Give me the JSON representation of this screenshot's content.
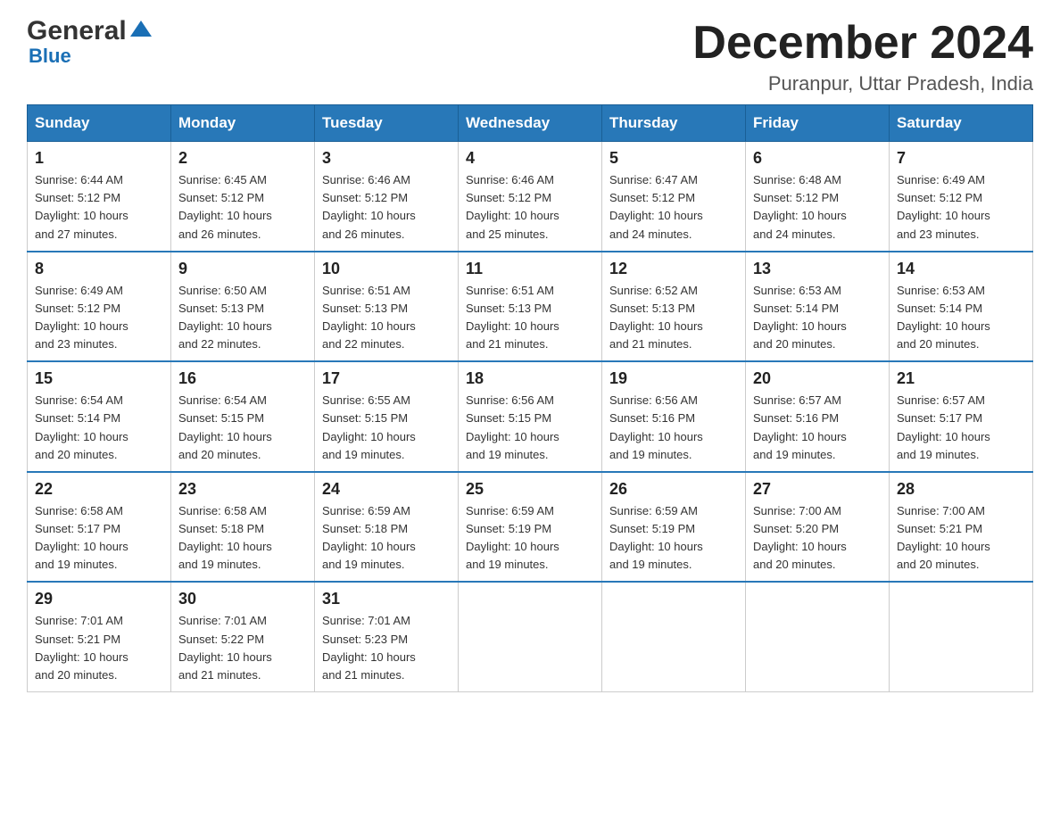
{
  "logo": {
    "general": "General",
    "blue": "Blue",
    "arrow": "▶"
  },
  "header": {
    "month_title": "December 2024",
    "location": "Puranpur, Uttar Pradesh, India"
  },
  "weekdays": [
    "Sunday",
    "Monday",
    "Tuesday",
    "Wednesday",
    "Thursday",
    "Friday",
    "Saturday"
  ],
  "weeks": [
    [
      {
        "day": "1",
        "sunrise": "6:44 AM",
        "sunset": "5:12 PM",
        "daylight": "10 hours and 27 minutes."
      },
      {
        "day": "2",
        "sunrise": "6:45 AM",
        "sunset": "5:12 PM",
        "daylight": "10 hours and 26 minutes."
      },
      {
        "day": "3",
        "sunrise": "6:46 AM",
        "sunset": "5:12 PM",
        "daylight": "10 hours and 26 minutes."
      },
      {
        "day": "4",
        "sunrise": "6:46 AM",
        "sunset": "5:12 PM",
        "daylight": "10 hours and 25 minutes."
      },
      {
        "day": "5",
        "sunrise": "6:47 AM",
        "sunset": "5:12 PM",
        "daylight": "10 hours and 24 minutes."
      },
      {
        "day": "6",
        "sunrise": "6:48 AM",
        "sunset": "5:12 PM",
        "daylight": "10 hours and 24 minutes."
      },
      {
        "day": "7",
        "sunrise": "6:49 AM",
        "sunset": "5:12 PM",
        "daylight": "10 hours and 23 minutes."
      }
    ],
    [
      {
        "day": "8",
        "sunrise": "6:49 AM",
        "sunset": "5:12 PM",
        "daylight": "10 hours and 23 minutes."
      },
      {
        "day": "9",
        "sunrise": "6:50 AM",
        "sunset": "5:13 PM",
        "daylight": "10 hours and 22 minutes."
      },
      {
        "day": "10",
        "sunrise": "6:51 AM",
        "sunset": "5:13 PM",
        "daylight": "10 hours and 22 minutes."
      },
      {
        "day": "11",
        "sunrise": "6:51 AM",
        "sunset": "5:13 PM",
        "daylight": "10 hours and 21 minutes."
      },
      {
        "day": "12",
        "sunrise": "6:52 AM",
        "sunset": "5:13 PM",
        "daylight": "10 hours and 21 minutes."
      },
      {
        "day": "13",
        "sunrise": "6:53 AM",
        "sunset": "5:14 PM",
        "daylight": "10 hours and 20 minutes."
      },
      {
        "day": "14",
        "sunrise": "6:53 AM",
        "sunset": "5:14 PM",
        "daylight": "10 hours and 20 minutes."
      }
    ],
    [
      {
        "day": "15",
        "sunrise": "6:54 AM",
        "sunset": "5:14 PM",
        "daylight": "10 hours and 20 minutes."
      },
      {
        "day": "16",
        "sunrise": "6:54 AM",
        "sunset": "5:15 PM",
        "daylight": "10 hours and 20 minutes."
      },
      {
        "day": "17",
        "sunrise": "6:55 AM",
        "sunset": "5:15 PM",
        "daylight": "10 hours and 19 minutes."
      },
      {
        "day": "18",
        "sunrise": "6:56 AM",
        "sunset": "5:15 PM",
        "daylight": "10 hours and 19 minutes."
      },
      {
        "day": "19",
        "sunrise": "6:56 AM",
        "sunset": "5:16 PM",
        "daylight": "10 hours and 19 minutes."
      },
      {
        "day": "20",
        "sunrise": "6:57 AM",
        "sunset": "5:16 PM",
        "daylight": "10 hours and 19 minutes."
      },
      {
        "day": "21",
        "sunrise": "6:57 AM",
        "sunset": "5:17 PM",
        "daylight": "10 hours and 19 minutes."
      }
    ],
    [
      {
        "day": "22",
        "sunrise": "6:58 AM",
        "sunset": "5:17 PM",
        "daylight": "10 hours and 19 minutes."
      },
      {
        "day": "23",
        "sunrise": "6:58 AM",
        "sunset": "5:18 PM",
        "daylight": "10 hours and 19 minutes."
      },
      {
        "day": "24",
        "sunrise": "6:59 AM",
        "sunset": "5:18 PM",
        "daylight": "10 hours and 19 minutes."
      },
      {
        "day": "25",
        "sunrise": "6:59 AM",
        "sunset": "5:19 PM",
        "daylight": "10 hours and 19 minutes."
      },
      {
        "day": "26",
        "sunrise": "6:59 AM",
        "sunset": "5:19 PM",
        "daylight": "10 hours and 19 minutes."
      },
      {
        "day": "27",
        "sunrise": "7:00 AM",
        "sunset": "5:20 PM",
        "daylight": "10 hours and 20 minutes."
      },
      {
        "day": "28",
        "sunrise": "7:00 AM",
        "sunset": "5:21 PM",
        "daylight": "10 hours and 20 minutes."
      }
    ],
    [
      {
        "day": "29",
        "sunrise": "7:01 AM",
        "sunset": "5:21 PM",
        "daylight": "10 hours and 20 minutes."
      },
      {
        "day": "30",
        "sunrise": "7:01 AM",
        "sunset": "5:22 PM",
        "daylight": "10 hours and 21 minutes."
      },
      {
        "day": "31",
        "sunrise": "7:01 AM",
        "sunset": "5:23 PM",
        "daylight": "10 hours and 21 minutes."
      },
      null,
      null,
      null,
      null
    ]
  ],
  "labels": {
    "sunrise": "Sunrise:",
    "sunset": "Sunset:",
    "daylight": "Daylight:"
  }
}
